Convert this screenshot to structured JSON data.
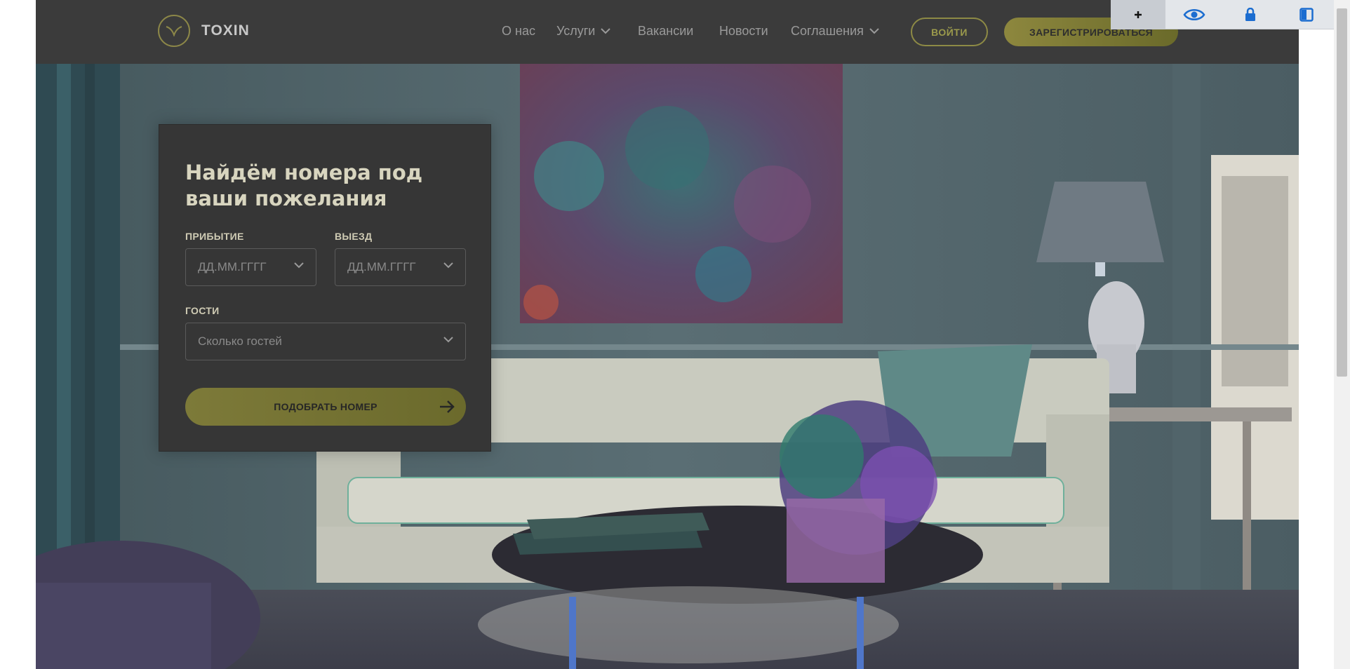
{
  "header": {
    "logo_text": "TOXIN",
    "nav": [
      {
        "label": "О нас",
        "has_dropdown": false
      },
      {
        "label": "Услуги",
        "has_dropdown": true
      },
      {
        "label": "Вакансии",
        "has_dropdown": false
      },
      {
        "label": "Новости",
        "has_dropdown": false
      },
      {
        "label": "Соглашения",
        "has_dropdown": true
      }
    ],
    "login_label": "ВОЙТИ",
    "register_label": "ЗАРЕГИСТРИРОВАТЬСЯ"
  },
  "search_card": {
    "title": "Найдём номера под ваши пожелания",
    "arrival_label": "ПРИБЫТИЕ",
    "arrival_placeholder": "ДД.ММ.ГГГГ",
    "departure_label": "ВЫЕЗД",
    "departure_placeholder": "ДД.ММ.ГГГГ",
    "guests_label": "ГОСТИ",
    "guests_placeholder": "Сколько гостей",
    "submit_label": "ПОДОБРАТЬ НОМЕР"
  },
  "extension_toolbar": {
    "icons": [
      "plus-icon",
      "eye-icon",
      "lock-icon",
      "sidebar-icon"
    ]
  },
  "colors": {
    "accent": "#8d873e",
    "header_bg": "#3b3b3b",
    "card_bg": "#363636"
  }
}
